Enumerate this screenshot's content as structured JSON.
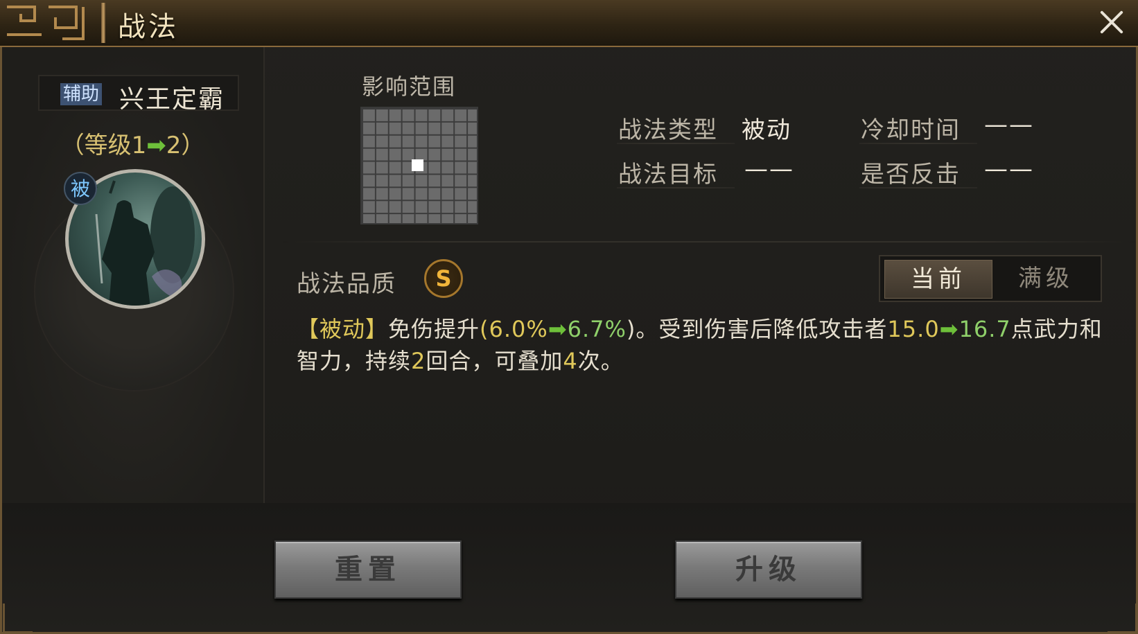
{
  "window": {
    "title": "战法"
  },
  "skill": {
    "type_tag": "辅助",
    "name": "兴王定霸",
    "level_open": "（等级1",
    "level_arrow": "➡",
    "level_close": "2）",
    "passive_badge": "被"
  },
  "range": {
    "label": "影响范围",
    "grid_size": 9,
    "center_cell": [
      4,
      4
    ]
  },
  "attributes": {
    "type_label": "战法类型",
    "type_value": "被动",
    "cooldown_label": "冷却时间",
    "cooldown_value": "——",
    "target_label": "战法目标",
    "target_value": "——",
    "counter_label": "是否反击",
    "counter_value": "——"
  },
  "quality": {
    "label": "战法品质",
    "grade": "S"
  },
  "toggle": {
    "current": "当前",
    "max": "满级"
  },
  "description": {
    "tag": "【被动】",
    "p1": "免伤提升",
    "open_paren": "(",
    "v1_from": "6.0%",
    "arrow": "➡",
    "v1_to": "6.7%",
    "p2": ")。受到伤害后降低攻击者",
    "v2_from": "15.0",
    "v2_to": "16.7",
    "p3": "点武力和智力，持续",
    "turns": "2",
    "p4": "回合，可叠加",
    "stacks": "4",
    "p5": "次。"
  },
  "buttons": {
    "reset": "重置",
    "upgrade": "升级"
  },
  "colors": {
    "accent_gold": "#e0c85a",
    "upgrade_green": "#8fd06a",
    "arrow_green": "#6ec03a",
    "quality_gold": "#f1b53a"
  }
}
